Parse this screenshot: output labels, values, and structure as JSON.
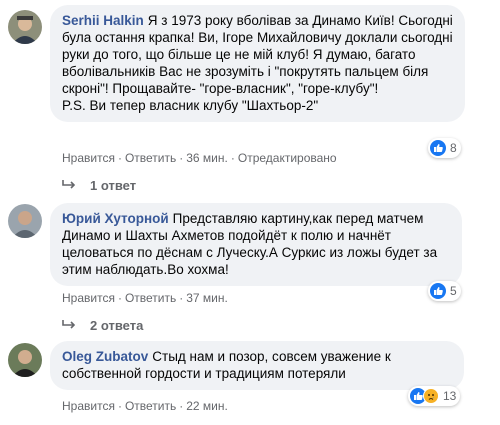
{
  "comments": [
    {
      "author": "Serhii Halkin",
      "text": "Я з 1973 року вболівав за Динамо Київ! Сьогодні була остання крапка! Ви, Ігоре Михайловичу доклали сьогодні руки до того, що більше це не мій клуб! Я думаю, багато вболівальників Вас не зрозуміть і \"покрутять пальцем біля скроні\"! Прощавайте- \"горе-власник\", \"горе-клубу\"!",
      "ps": "P.S. Ви тепер власник клубу \"Шахтьор-2\"",
      "like_label": "Нравится",
      "reply_label": "Ответить",
      "time": "36 мин.",
      "edited": "Отредактировано",
      "reaction_count": "8",
      "replies_label": "1 ответ"
    },
    {
      "author": "Юрий Хуторной",
      "text": "Представляю картину,как перед матчем Динамо и Шахты Ахметов подойдёт к полю и начнёт целоваться по дёснам с Луческу.А Суркис из ложы будет за этим наблюдать.Во хохма!",
      "like_label": "Нравится",
      "reply_label": "Ответить",
      "time": "37 мин.",
      "reaction_count": "5",
      "replies_label": "2 ответа"
    },
    {
      "author": "Oleg Zubatov",
      "text": "Стыд нам и позор, совсем уважение к собственной гордости и традициям потеряли",
      "like_label": "Нравится",
      "reply_label": "Ответить",
      "time": "22 мин.",
      "reaction_count": "13"
    }
  ],
  "colors": {
    "author": "#385898",
    "bubble": "#f0f2f5",
    "meta": "#65676b",
    "like": "#1877f2",
    "sad": "#f7b125"
  },
  "icons": [
    "like-icon",
    "sad-icon",
    "reply-arrow-icon"
  ]
}
